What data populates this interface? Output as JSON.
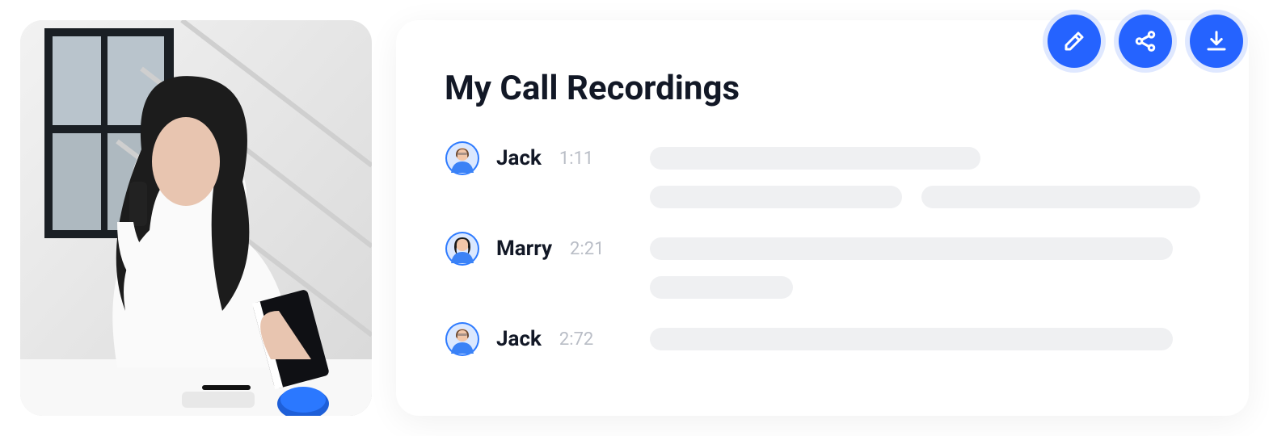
{
  "card": {
    "title": "My Call Recordings"
  },
  "recordings": [
    {
      "name": "Jack",
      "time": "1:11",
      "avatar": "male"
    },
    {
      "name": "Marry",
      "time": "2:21",
      "avatar": "female"
    },
    {
      "name": "Jack",
      "time": "2:72",
      "avatar": "male"
    }
  ],
  "actions": {
    "edit": "edit",
    "share": "share",
    "download": "download"
  },
  "colors": {
    "accent": "#2563FF",
    "text": "#121826",
    "muted": "#B9BDC6",
    "placeholder": "#EFF0F2"
  }
}
